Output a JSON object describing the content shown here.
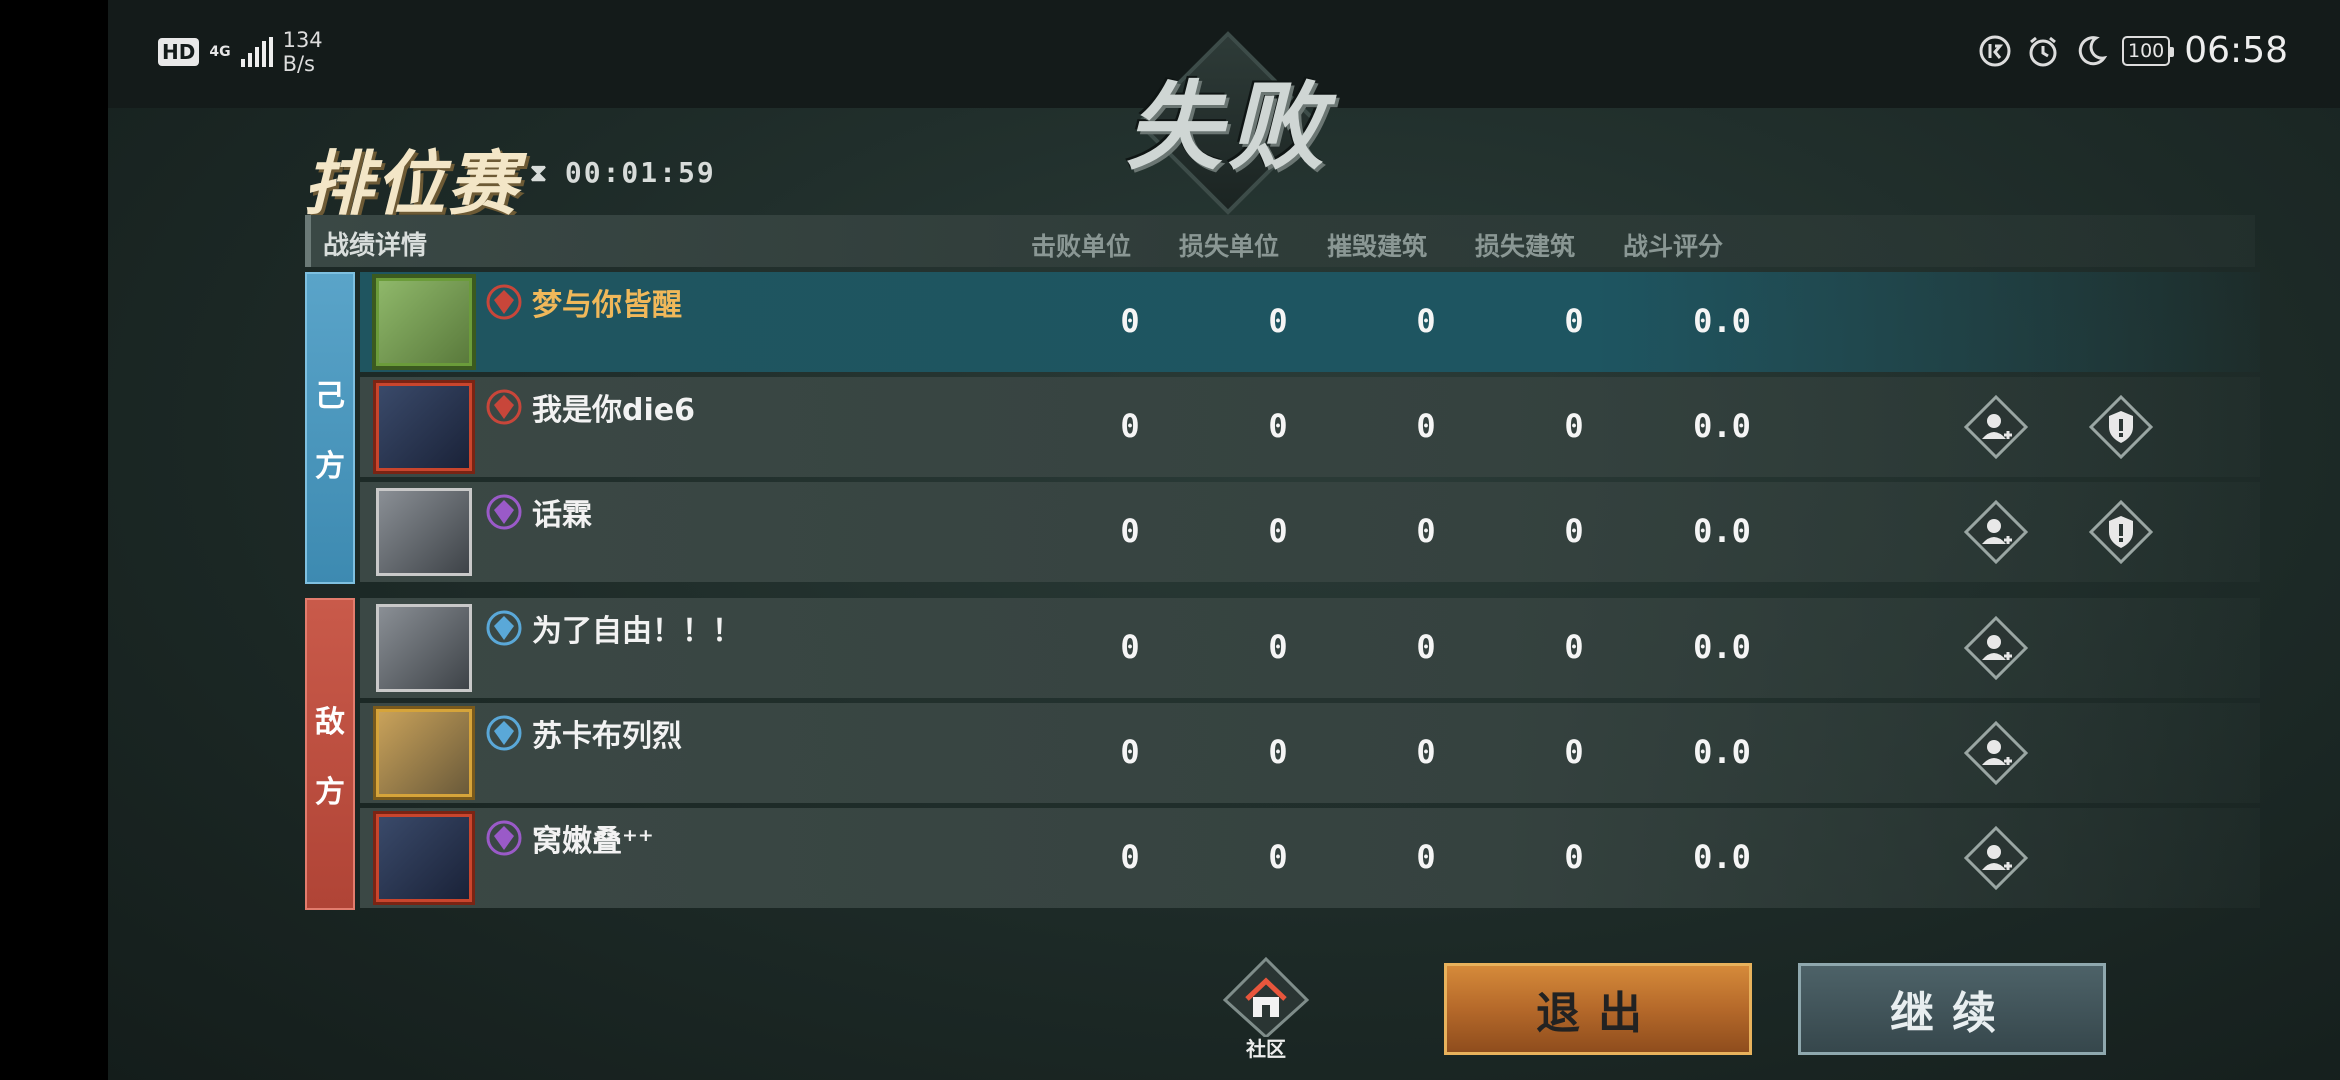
{
  "status_bar": {
    "hd": "HD",
    "network": "4G",
    "speed_value": "134",
    "speed_unit": "B/s",
    "battery": "100",
    "time": "06:58"
  },
  "result_title": "失败",
  "mode_title": "排位赛",
  "timer": "00:01:59",
  "table": {
    "section_title": "战绩详情",
    "columns": [
      "击败单位",
      "损失单位",
      "摧毁建筑",
      "损失建筑",
      "战斗评分"
    ]
  },
  "sides": {
    "ally": "己方",
    "enemy": "敌方"
  },
  "ally_players": [
    {
      "name": "梦与你皆醒",
      "stats": [
        "0",
        "0",
        "0",
        "0",
        "0.0"
      ],
      "rank": "red",
      "frame": "green"
    },
    {
      "name": "我是你die6",
      "stats": [
        "0",
        "0",
        "0",
        "0",
        "0.0"
      ],
      "rank": "red",
      "frame": "red"
    },
    {
      "name": "话霖",
      "stats": [
        "0",
        "0",
        "0",
        "0",
        "0.0"
      ],
      "rank": "purple",
      "frame": "plain"
    }
  ],
  "enemy_players": [
    {
      "name": "为了自由！！！",
      "stats": [
        "0",
        "0",
        "0",
        "0",
        "0.0"
      ],
      "rank": "blue",
      "frame": "plain"
    },
    {
      "name": "苏卡布列烈",
      "stats": [
        "0",
        "0",
        "0",
        "0",
        "0.0"
      ],
      "rank": "blue",
      "frame": "gold"
    },
    {
      "name": "窝嫩叠⁺⁺",
      "stats": [
        "0",
        "0",
        "0",
        "0",
        "0.0"
      ],
      "rank": "purple",
      "frame": "red"
    }
  ],
  "bottom": {
    "community_label": "社区",
    "exit_label": "退出",
    "continue_label": "继续"
  },
  "colors": {
    "ally": "#4a98c0",
    "enemy": "#c24d3e",
    "highlight_row": "#1f5560",
    "exit_button": "#c47a33",
    "name_highlight": "#f0b85a"
  }
}
